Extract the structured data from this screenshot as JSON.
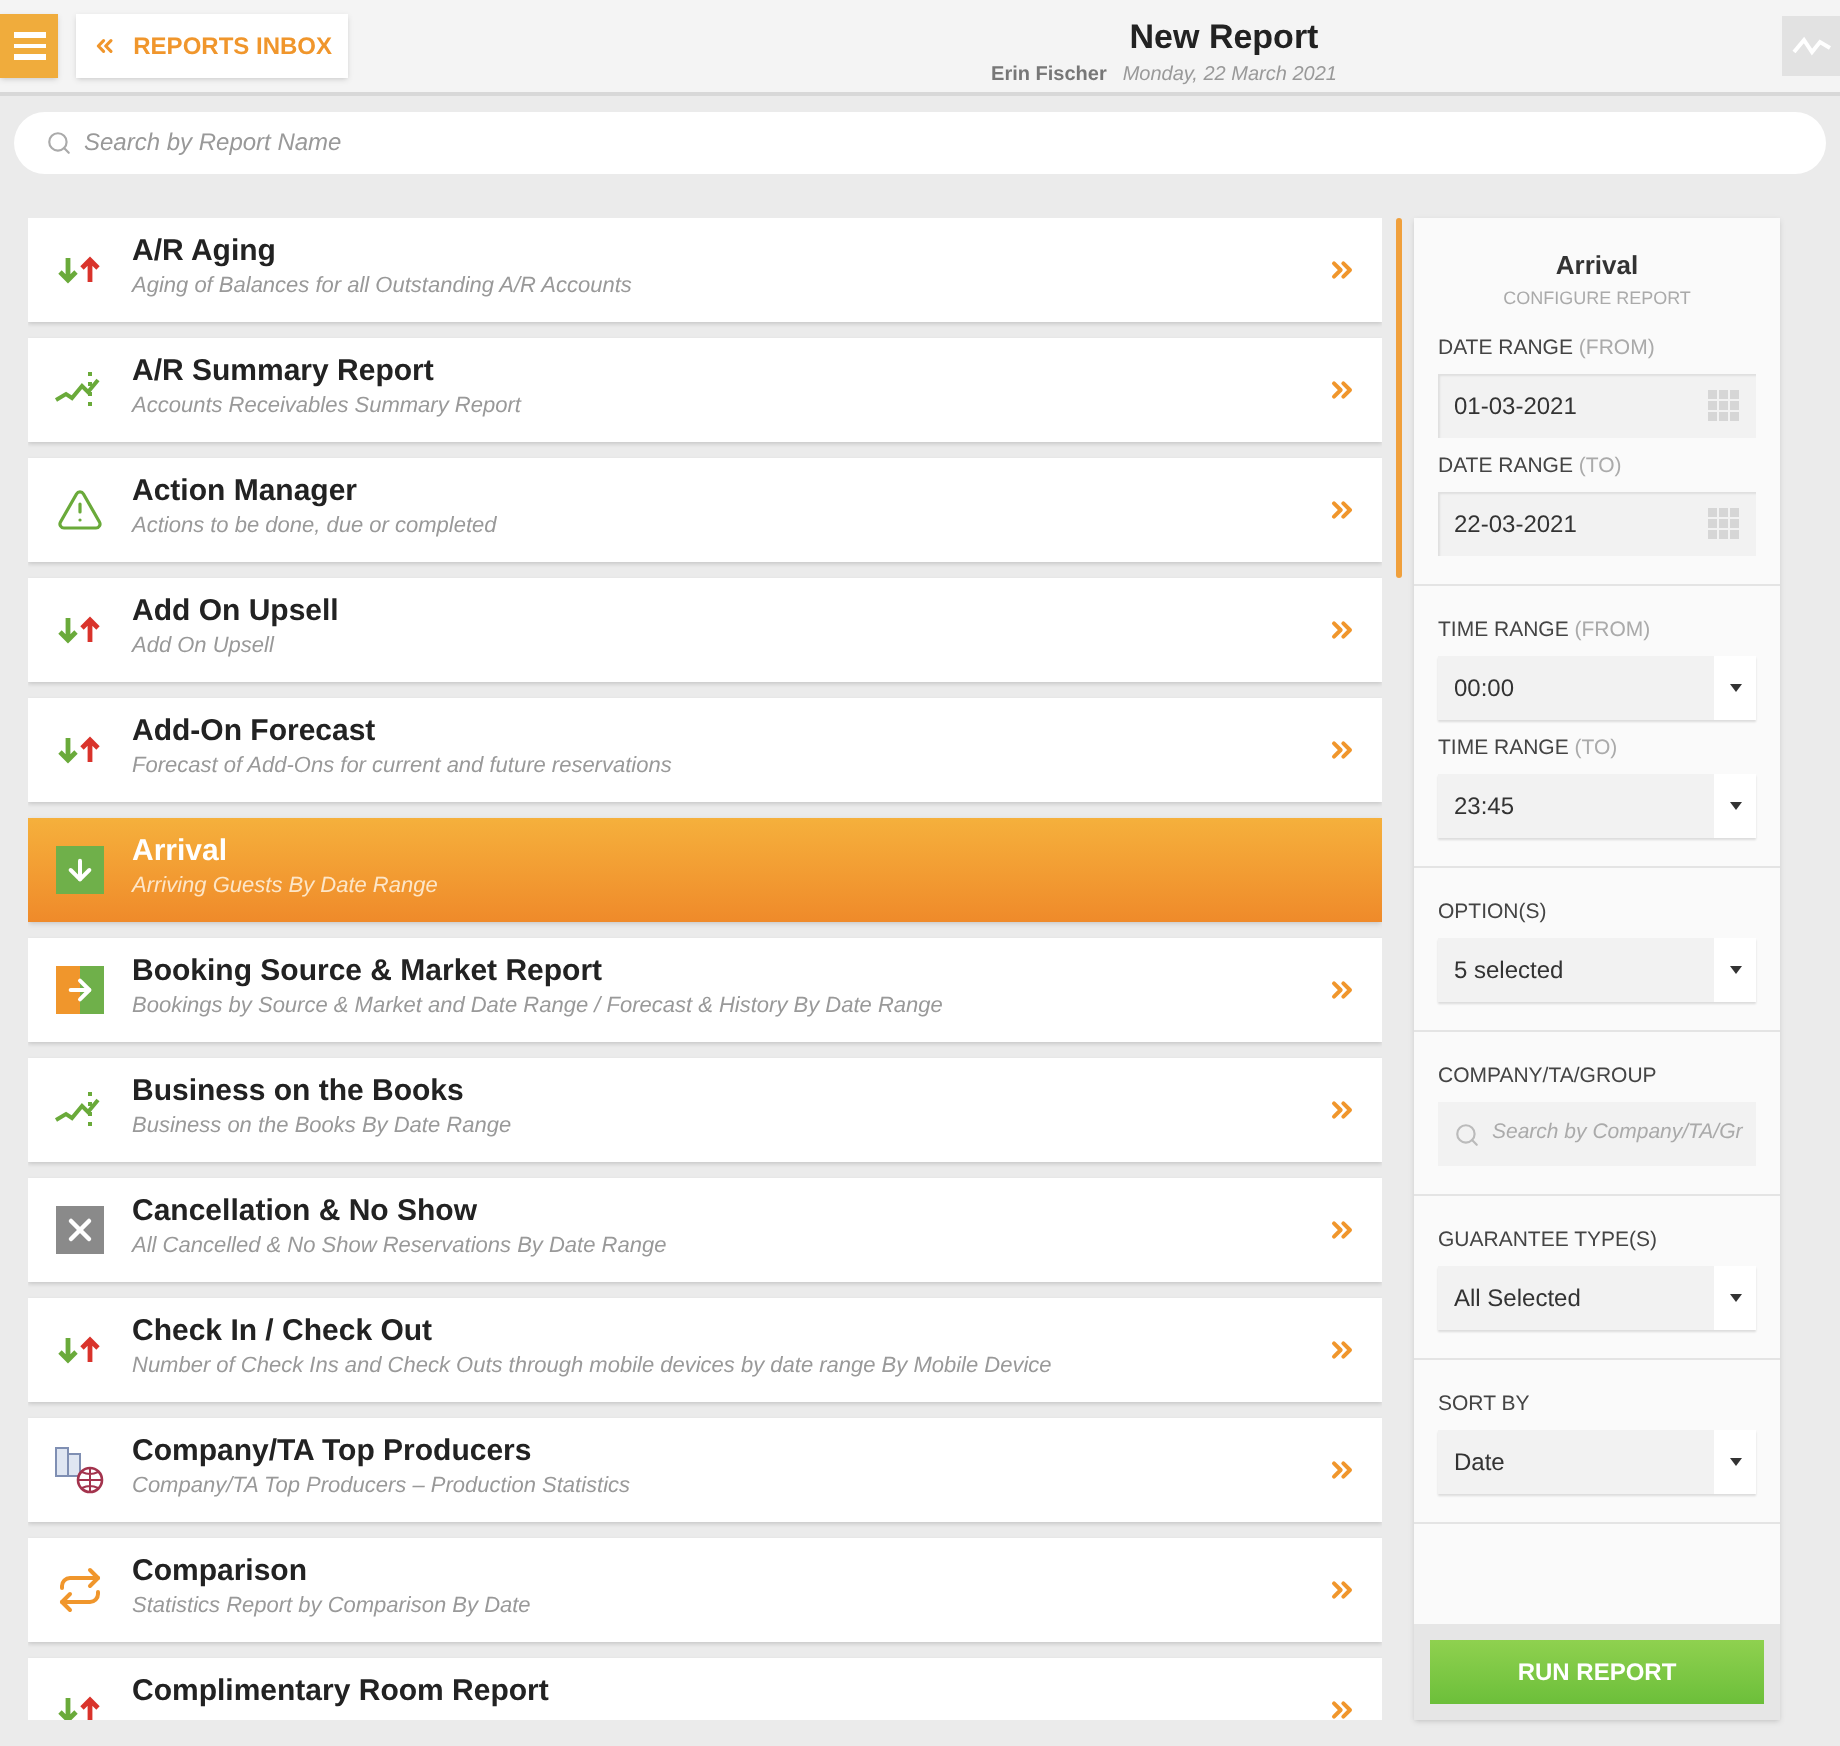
{
  "header": {
    "back_button": "REPORTS INBOX",
    "title": "New Report",
    "user": "Erin Fischer",
    "date": "Monday, 22 March 2021"
  },
  "search": {
    "placeholder": "Search by Report Name"
  },
  "reports": [
    {
      "title": "A/R Aging",
      "subtitle": "Aging of Balances for all Outstanding A/R Accounts",
      "kind": "updown",
      "selected": false
    },
    {
      "title": "A/R Summary Report",
      "subtitle": "Accounts Receivables Summary Report",
      "kind": "trend",
      "selected": false
    },
    {
      "title": "Action Manager",
      "subtitle": "Actions to be done, due or completed",
      "kind": "warning",
      "selected": false
    },
    {
      "title": "Add On Upsell",
      "subtitle": "Add On Upsell",
      "kind": "updown",
      "selected": false
    },
    {
      "title": "Add-On Forecast",
      "subtitle": "Forecast of Add-Ons for current and future reservations",
      "kind": "updown",
      "selected": false
    },
    {
      "title": "Arrival",
      "subtitle": "Arriving Guests By Date Range",
      "kind": "arrival",
      "selected": true
    },
    {
      "title": "Booking Source & Market Report",
      "subtitle": "Bookings by Source & Market and Date Range / Forecast & History By Date Range",
      "kind": "source",
      "selected": false
    },
    {
      "title": "Business on the Books",
      "subtitle": "Business on the Books By Date Range",
      "kind": "trend",
      "selected": false
    },
    {
      "title": "Cancellation & No Show",
      "subtitle": "All Cancelled & No Show Reservations By Date Range",
      "kind": "cancel",
      "selected": false
    },
    {
      "title": "Check In / Check Out",
      "subtitle": "Number of Check Ins and Check Outs through mobile devices by date range By Mobile Device",
      "kind": "updown",
      "selected": false
    },
    {
      "title": "Company/TA Top Producers",
      "subtitle": "Company/TA Top Producers – Production Statistics",
      "kind": "company",
      "selected": false
    },
    {
      "title": "Comparison",
      "subtitle": "Statistics Report by Comparison By Date",
      "kind": "compare",
      "selected": false
    },
    {
      "title": "Complimentary Room Report",
      "kind": "updown",
      "selected": false
    }
  ],
  "config": {
    "title": "Arrival",
    "subtitle": "CONFIGURE REPORT",
    "sections": [
      {
        "fields": [
          {
            "label": "DATE RANGE",
            "hint": "(FROM)",
            "kind": "date",
            "value": "01-03-2021"
          },
          {
            "label": "DATE RANGE",
            "hint": "(TO)",
            "kind": "date",
            "value": "22-03-2021"
          }
        ]
      },
      {
        "fields": [
          {
            "label": "TIME RANGE",
            "hint": "(FROM)",
            "kind": "select",
            "value": "00:00"
          },
          {
            "label": "TIME RANGE",
            "hint": "(TO)",
            "kind": "select",
            "value": "23:45"
          }
        ]
      },
      {
        "fields": [
          {
            "label": "OPTION(S)",
            "kind": "select",
            "value": "5 selected"
          }
        ]
      },
      {
        "fields": [
          {
            "label": "COMPANY/TA/GROUP",
            "kind": "search",
            "placeholder": "Search by Company/TA/Gr"
          }
        ]
      },
      {
        "fields": [
          {
            "label": "GUARANTEE TYPE(S)",
            "kind": "select",
            "value": "All Selected"
          }
        ]
      },
      {
        "fields": [
          {
            "label": "SORT BY",
            "kind": "select",
            "value": "Date"
          }
        ]
      }
    ],
    "run_button": "RUN REPORT"
  }
}
